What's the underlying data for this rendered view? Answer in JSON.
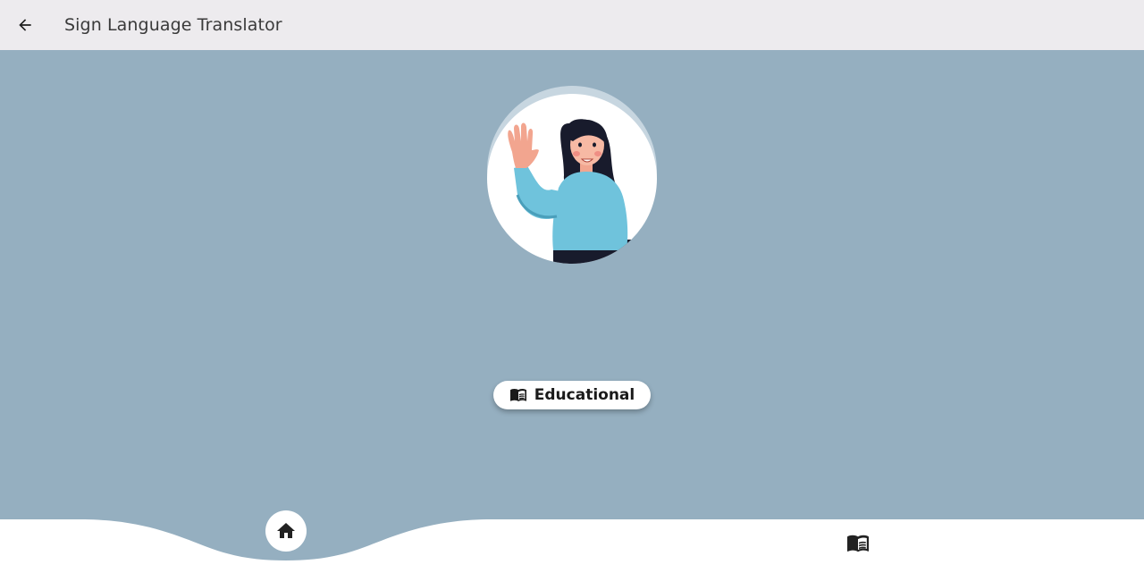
{
  "appbar": {
    "title": "Sign Language Translator",
    "back_icon": "arrow-left-icon"
  },
  "main": {
    "avatar_icon": "waving-woman-illustration",
    "educational_button": {
      "label": "Educational",
      "icon": "menu-book-icon"
    }
  },
  "bottom_nav": {
    "items": [
      {
        "icon": "home-icon",
        "active": true
      },
      {
        "icon": "menu-book-icon",
        "active": false
      }
    ]
  },
  "colors": {
    "background": "#95afc0",
    "appbar": "#edebee",
    "white": "#ffffff"
  }
}
